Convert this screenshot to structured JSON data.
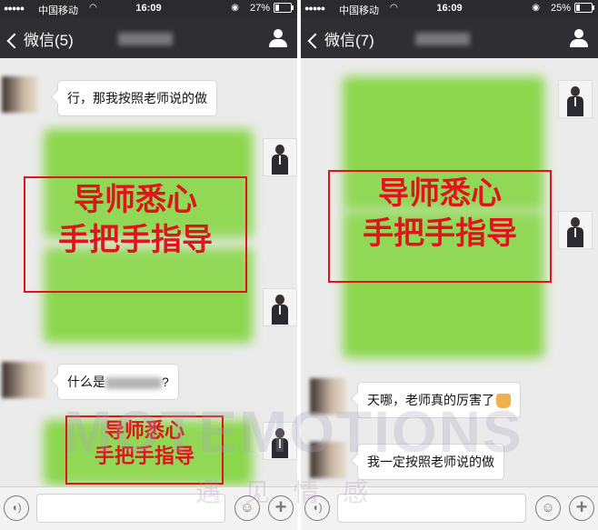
{
  "left": {
    "status": {
      "signal": "●●●●●",
      "carrier": "中国移动",
      "wifi": "WiFi",
      "time": "16:09",
      "battery": "27%",
      "battery_fraction": 0.27
    },
    "nav": {
      "back_label": "微信(5)"
    },
    "messages": {
      "m1": "行，那我按照老师说的做",
      "m2": "什么是",
      "m2_tail": "?"
    },
    "stamp_large": {
      "line1": "导师悉心",
      "line2": "手把手指导"
    },
    "stamp_small": {
      "line1": "导师悉心",
      "line2": "手把手指导"
    }
  },
  "right": {
    "status": {
      "signal": "●●●●●",
      "carrier": "中国移动",
      "wifi": "WiFi",
      "time": "16:09",
      "battery": "25%",
      "battery_fraction": 0.25
    },
    "nav": {
      "back_label": "微信(7)"
    },
    "messages": {
      "m1": "天哪，老师真的厉害了",
      "m2": "我一定按照老师说的做"
    },
    "stamp_large": {
      "line1": "导师悉心",
      "line2": "手把手指导"
    }
  },
  "watermark": {
    "latin": "MOTEMOTIONS",
    "chinese": "遇见情感"
  },
  "icons": {
    "voice": "voice-icon",
    "emoji": "emoji-icon",
    "plus": "plus-icon",
    "contact": "contact-icon",
    "back": "chevron-left-icon"
  }
}
